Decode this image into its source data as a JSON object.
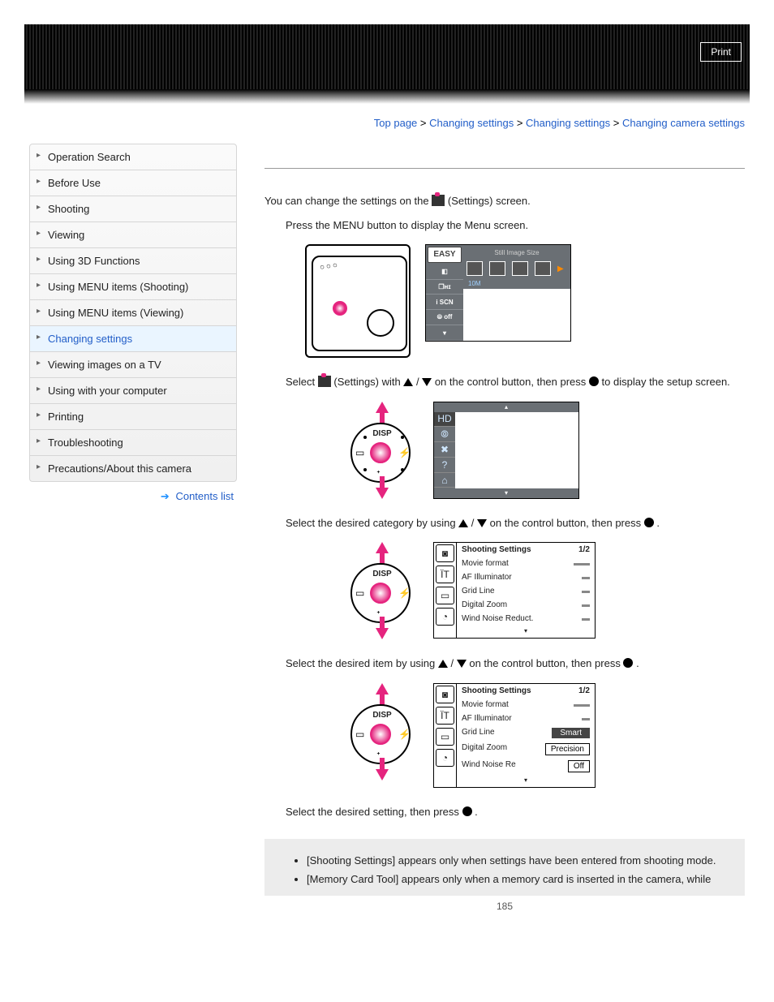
{
  "header": {
    "print_label": "Print"
  },
  "breadcrumb": {
    "items": [
      "Top page",
      "Changing settings",
      "Changing settings",
      "Changing camera settings"
    ],
    "sep": " > "
  },
  "sidebar": {
    "items": [
      {
        "label": "Operation Search"
      },
      {
        "label": "Before Use"
      },
      {
        "label": "Shooting"
      },
      {
        "label": "Viewing"
      },
      {
        "label": "Using 3D Functions"
      },
      {
        "label": "Using MENU items (Shooting)"
      },
      {
        "label": "Using MENU items (Viewing)"
      },
      {
        "label": "Changing settings"
      },
      {
        "label": "Viewing images on a TV"
      },
      {
        "label": "Using with your computer"
      },
      {
        "label": "Printing"
      },
      {
        "label": "Troubleshooting"
      },
      {
        "label": "Precautions/About this camera"
      }
    ],
    "active_index": 7,
    "contents_list_label": "Contents list"
  },
  "main": {
    "intro_a": "You can change the settings on the ",
    "intro_b": "(Settings) screen.",
    "step1": "Press the MENU button to display the Menu screen.",
    "menu_screen": {
      "sidebar": [
        "EASY",
        "◧",
        "❐ʜɪ",
        "i SCN",
        "⦾ off",
        "▾"
      ],
      "top_label": "Still Image Size",
      "foot_label": "10M"
    },
    "step2_a": "Select ",
    "step2_b": "(Settings) with ",
    "step2_c": " on the control button, then press ",
    "step2_d": " to display the setup screen.",
    "disp_label": "DISP",
    "settings_icons": [
      "▴",
      "HD",
      "⦾",
      "✖",
      "?",
      "⌂",
      "▾"
    ],
    "step3_a": "Select the desired category by using ",
    "step3_b": " on the control button, then press ",
    "step3_c": " .",
    "shoot_settings": {
      "title": "Shooting Settings",
      "page": "1/2",
      "rows": [
        {
          "label": "Movie format",
          "value": ""
        },
        {
          "label": "AF Illuminator",
          "value": ""
        },
        {
          "label": "Grid Line",
          "value": ""
        },
        {
          "label": "Digital Zoom",
          "value": ""
        },
        {
          "label": "Wind Noise Reduct.",
          "value": ""
        }
      ],
      "icons": [
        "◙",
        "ÏT",
        "▭",
        "◔"
      ]
    },
    "step4_a": "Select the desired item by using ",
    "step4_b": " on the control button, then press ",
    "step4_c": " .",
    "shoot_settings2": {
      "title": "Shooting Settings",
      "page": "1/2",
      "rows": [
        {
          "label": "Movie format",
          "value": ""
        },
        {
          "label": "AF Illuminator",
          "value": ""
        },
        {
          "label": "Grid Line",
          "value": "Smart",
          "selected": true
        },
        {
          "label": "Digital Zoom",
          "value": "Precision"
        },
        {
          "label": "Wind Noise Re",
          "value": "Off"
        }
      ],
      "icons": [
        "◙",
        "ÏT",
        "▭",
        "◔"
      ]
    },
    "step5_a": "Select the desired setting, then press ",
    "step5_b": " .",
    "notes": [
      "[Shooting Settings] appears only when settings have been entered from shooting mode.",
      "[Memory Card Tool] appears only when a memory card is inserted in the camera, while"
    ],
    "page_number": "185"
  }
}
